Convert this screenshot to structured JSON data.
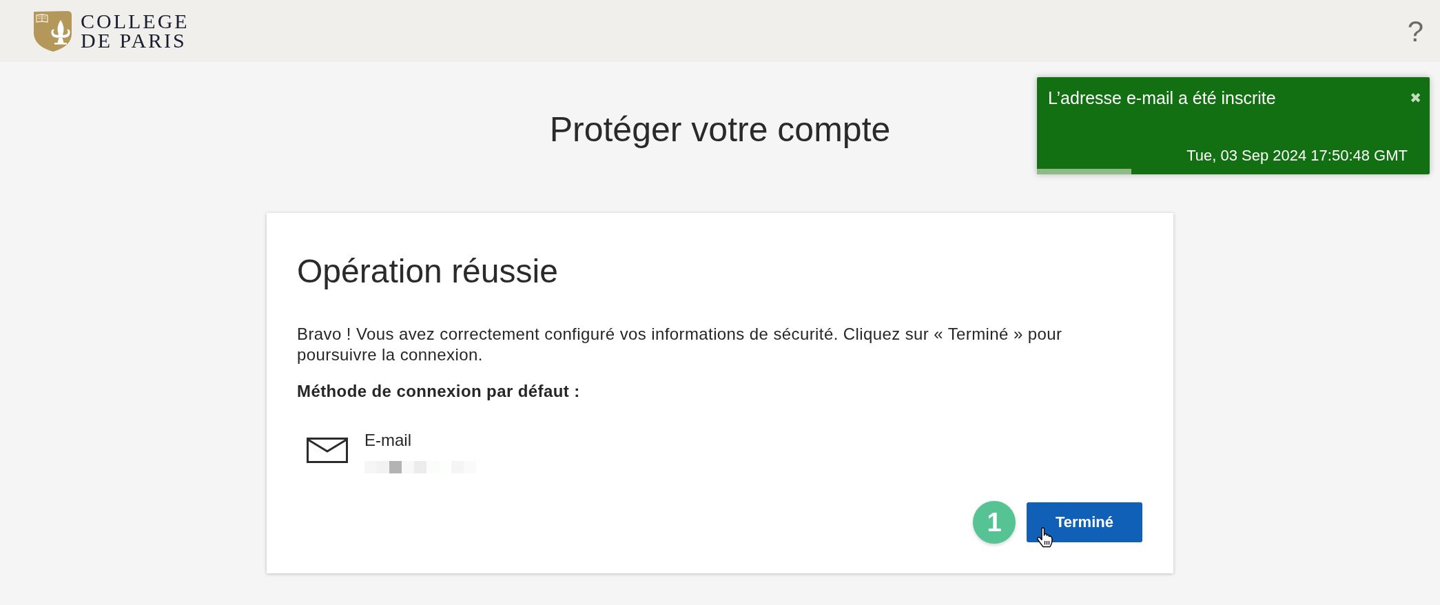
{
  "header": {
    "logo_lines": [
      "COLLEGE",
      "DE PARIS"
    ],
    "help": "?"
  },
  "toast": {
    "message": "L’adresse e-mail a été inscrite",
    "close": "✖",
    "timestamp": "Tue, 03 Sep 2024 17:50:48 GMT",
    "level": 0.24
  },
  "page_title": "Protéger votre compte",
  "card": {
    "title": "Opération réussie",
    "message": "Bravo ! Vous avez correctement configuré vos informations de sécurité. Cliquez sur « Terminé » pour poursuivre la connexion.",
    "method_label": "Méthode de connexion par défaut :",
    "method": {
      "kind": "email",
      "name": "E-mail",
      "redacted": true
    },
    "step_badge": "1",
    "button": "Terminé"
  }
}
